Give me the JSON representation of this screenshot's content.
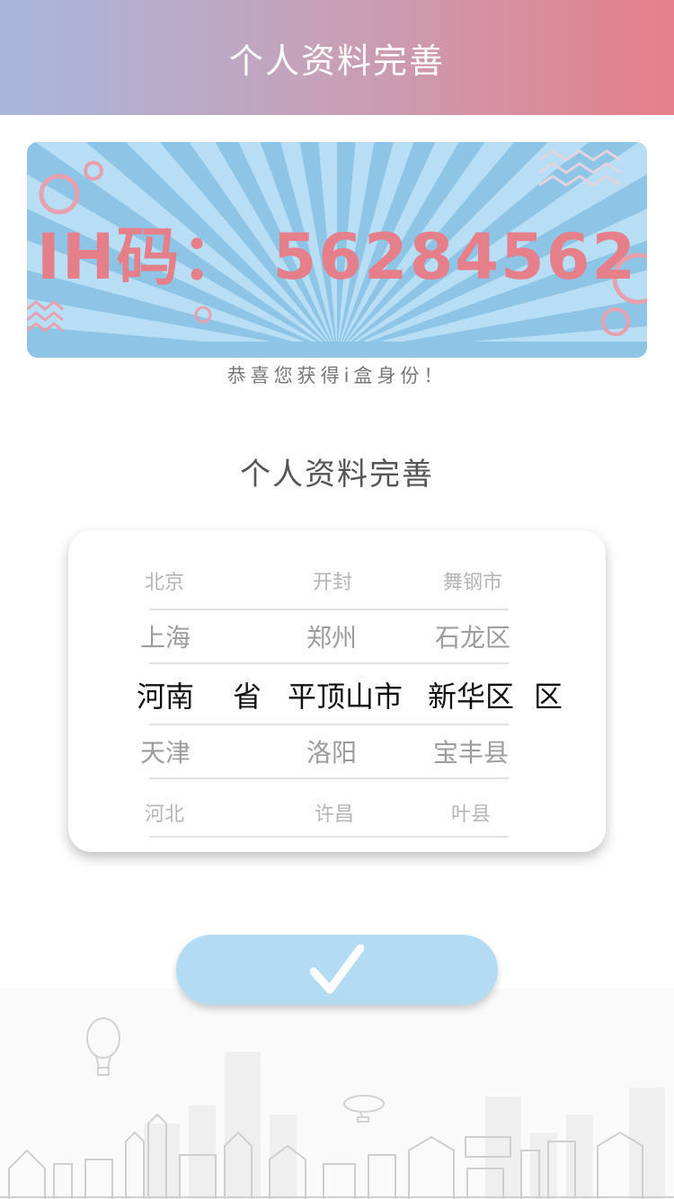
{
  "header": {
    "title": "个人资料完善"
  },
  "banner": {
    "code_label": "IH码：",
    "code_value": "56284562"
  },
  "congrats_text": "恭喜您获得i盒身份！",
  "section_title": "个人资料完善",
  "picker": {
    "rows": [
      {
        "province": "北京",
        "city": "开封",
        "district": "舞钢市"
      },
      {
        "province": "上海",
        "city": "郑州",
        "district": "石龙区"
      },
      {
        "province": "河南",
        "city": "平顶山",
        "district": "新华区"
      },
      {
        "province": "天津",
        "city": "洛阳",
        "district": "宝丰县"
      },
      {
        "province": "河北",
        "city": "许昌",
        "district": "叶县"
      }
    ],
    "unit_province": "省",
    "unit_city": "市",
    "unit_district": "区",
    "selected_index": 2
  },
  "confirm_button": {
    "icon": "check-icon"
  },
  "colors": {
    "header_start": "#a9b7dd",
    "header_end": "#e57f89",
    "code": "#e57f89",
    "button": "#b3dcf4"
  }
}
